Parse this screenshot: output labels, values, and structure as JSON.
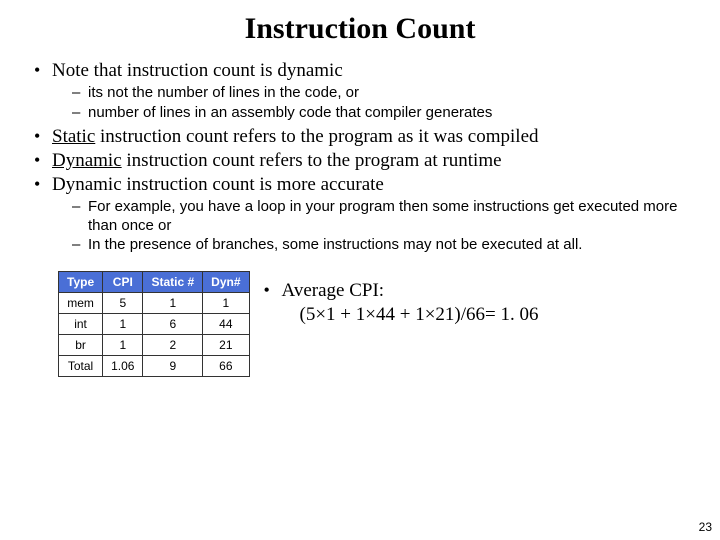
{
  "title": "Instruction Count",
  "bullets": {
    "b1": "Note that instruction count is dynamic",
    "b1_sub1": "its not the number of lines in the code, or",
    "b1_sub2": "number of lines in an assembly code that compiler generates",
    "b2_u": "Static",
    "b2_rest": " instruction count refers to the program as it was compiled",
    "b3_u": "Dynamic",
    "b3_rest": " instruction count refers to the program at runtime",
    "b4": "Dynamic instruction count is more accurate",
    "b4_sub1": "For example, you have a loop in your program then some instructions get executed more than once or",
    "b4_sub2": "In the presence of branches, some instructions may not be executed at all."
  },
  "table": {
    "headers": {
      "h1": "Type",
      "h2": "CPI",
      "h3": "Static #",
      "h4": "Dyn#"
    },
    "rows": [
      {
        "c1": "mem",
        "c2": "5",
        "c3": "1",
        "c4": "1"
      },
      {
        "c1": "int",
        "c2": "1",
        "c3": "6",
        "c4": "44"
      },
      {
        "c1": "br",
        "c2": "1",
        "c3": "2",
        "c4": "21"
      },
      {
        "c1": "Total",
        "c2": "1.06",
        "c3": "9",
        "c4": "66"
      }
    ]
  },
  "avg": {
    "label": "Average CPI:",
    "calc": "(5×1 + 1×44 + 1×21)/66= 1. 06"
  },
  "page_number": "23"
}
